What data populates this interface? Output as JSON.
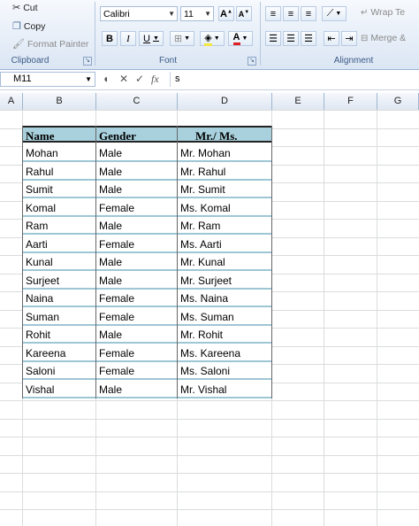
{
  "ribbon": {
    "clipboard": {
      "cut": "Cut",
      "copy": "Copy",
      "format_painter": "Format Painter",
      "label": "Clipboard"
    },
    "font": {
      "name": "Calibri",
      "size": "11",
      "bold": "B",
      "italic": "I",
      "underline": "U",
      "label": "Font"
    },
    "alignment": {
      "wrap_text": "Wrap Te",
      "merge": "Merge &",
      "label": "Alignment"
    }
  },
  "formula_bar": {
    "name_box": "M11",
    "formula": "s"
  },
  "columns": [
    "A",
    "B",
    "C",
    "D",
    "E",
    "F",
    "G"
  ],
  "table": {
    "headers": [
      "Name",
      "Gender",
      "Mr./ Ms."
    ],
    "rows": [
      [
        "Mohan",
        "Male",
        "Mr. Mohan"
      ],
      [
        "Rahul",
        "Male",
        "Mr. Rahul"
      ],
      [
        "Sumit",
        "Male",
        "Mr. Sumit"
      ],
      [
        "Komal",
        "Female",
        "Ms.  Komal"
      ],
      [
        "Ram",
        "Male",
        "Mr. Ram"
      ],
      [
        "Aarti",
        "Female",
        "Ms.  Aarti"
      ],
      [
        "Kunal",
        "Male",
        "Mr. Kunal"
      ],
      [
        "Surjeet",
        "Male",
        "Mr. Surjeet"
      ],
      [
        "Naina",
        "Female",
        "Ms.  Naina"
      ],
      [
        "Suman",
        "Female",
        "Ms.  Suman"
      ],
      [
        "Rohit",
        "Male",
        "Mr. Rohit"
      ],
      [
        "Kareena",
        "Female",
        "Ms.  Kareena"
      ],
      [
        "Saloni",
        "Female",
        "Ms.  Saloni"
      ],
      [
        "Vishal",
        "Male",
        "Mr. Vishal"
      ]
    ]
  }
}
